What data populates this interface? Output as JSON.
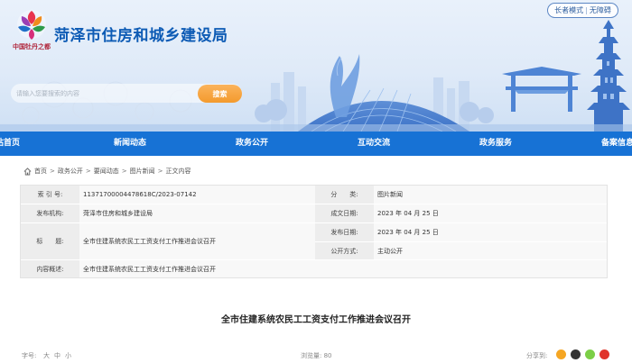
{
  "header": {
    "logo_caption": "中国牡丹之都",
    "site_title": "菏泽市住房和城乡建设局",
    "elder_mode": "长者模式",
    "accessibility": "无障碍",
    "search_placeholder": "请输入您要搜索的内容",
    "search_button": "搜索"
  },
  "nav": {
    "items": [
      "网站首页",
      "新闻动态",
      "政务公开",
      "互动交流",
      "政务服务",
      "备案信息"
    ]
  },
  "breadcrumb": {
    "items": [
      "首页",
      "政务公开",
      "要闻动态",
      "图片新闻",
      "正文内容"
    ],
    "separator": ">"
  },
  "info": {
    "index_label": "索 引 号:",
    "index_value": "11371700004478618C/2023-07142",
    "category_label": "分　　类:",
    "category_value": "图片新闻",
    "issuer_label": "发布机构:",
    "issuer_value": "菏泽市住房和城乡建设局",
    "created_label": "成文日期:",
    "created_value": "2023 年 04 月 25 日",
    "title_label": "标　　题:",
    "title_value": "全市住建系统农民工工资支付工作推进会议召开",
    "published_label": "发布日期:",
    "published_value": "2023 年 04 月 25 日",
    "disclosure_label": "公开方式:",
    "disclosure_value": "主动公开",
    "summary_label": "内容概述:",
    "summary_value": "全市住建系统农民工工资支付工作推进会议召开"
  },
  "article": {
    "title": "全市住建系统农民工工资支付工作推进会议召开"
  },
  "toolbar": {
    "font_size_label": "字号:",
    "font_large": "大",
    "font_medium": "中",
    "font_small": "小",
    "views": "浏览量: 80",
    "share_label": "分享到:"
  },
  "colors": {
    "nav_blue": "#1772d5",
    "title_blue": "#0d5bb5",
    "search_orange": "#f5a23a",
    "share_icons": [
      "#f5a623",
      "#333333",
      "#7ccf47",
      "#e0342b"
    ]
  }
}
